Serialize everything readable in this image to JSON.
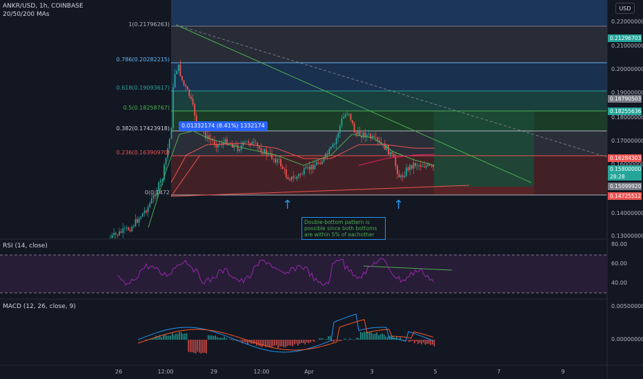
{
  "header": {
    "symbol_line": "ANKR/USD, 1h, COINBASE",
    "ma_line": "20/50/200 MAs",
    "currency_button": "USD"
  },
  "panes": {
    "rsi_label": "RSI (14, close)",
    "macd_label": "MACD (12, 26, close, 9)"
  },
  "price_axis": [
    "0.22000000",
    "0.21000000",
    "0.20000000",
    "0.19000000",
    "0.18000000",
    "0.17000000",
    "0.16000000",
    "0.14000000",
    "0.13000000"
  ],
  "price_tags": [
    {
      "text": "0.21296703",
      "color": "#26a69a"
    },
    {
      "text": "0.18790503",
      "color": "#787b86"
    },
    {
      "text": "0.18255636",
      "color": "#26a69a"
    },
    {
      "text": "0.16284303",
      "color": "#ef5350"
    },
    {
      "text": "0.15800000",
      "color": "#26a69a"
    },
    {
      "text": "28:28",
      "color": "#26a69a"
    },
    {
      "text": "0.15099920",
      "color": "#787b86"
    },
    {
      "text": "0.14725512",
      "color": "#ef5350"
    }
  ],
  "rsi_axis": [
    "80.00",
    "60.00",
    "40.00"
  ],
  "macd_axis": [
    "0.00500000",
    "0.00000000"
  ],
  "time_axis": [
    "26",
    "12:00",
    "29",
    "12:00",
    "Apr",
    "3",
    "5",
    "7",
    "9"
  ],
  "fib_levels": [
    {
      "label": "1(0.21796263)",
      "color": "#b2b5be"
    },
    {
      "label": "0.786(0.20282215)",
      "color": "#64b5f6"
    },
    {
      "label": "0.618(0.19093617)",
      "color": "#26a69a"
    },
    {
      "label": "0.5(0.18258767)",
      "color": "#4caf50"
    },
    {
      "label": "0.382(0.17423918)",
      "color": "#d1d4dc"
    },
    {
      "label": "0.236(0.16390970)",
      "color": "#ef5350"
    },
    {
      "label": "0(0.1472",
      "color": "#b2b5be"
    }
  ],
  "measure_label": "0.01332174 (8.41%) 1332174",
  "annotation": "Double-bottom pattern is possible since both bottoms are within 5% of eachother",
  "colors": {
    "background": "#131722",
    "up": "#26a69a",
    "down": "#ef5350",
    "rsi": "#9c27b0",
    "accent": "#2962ff"
  }
}
